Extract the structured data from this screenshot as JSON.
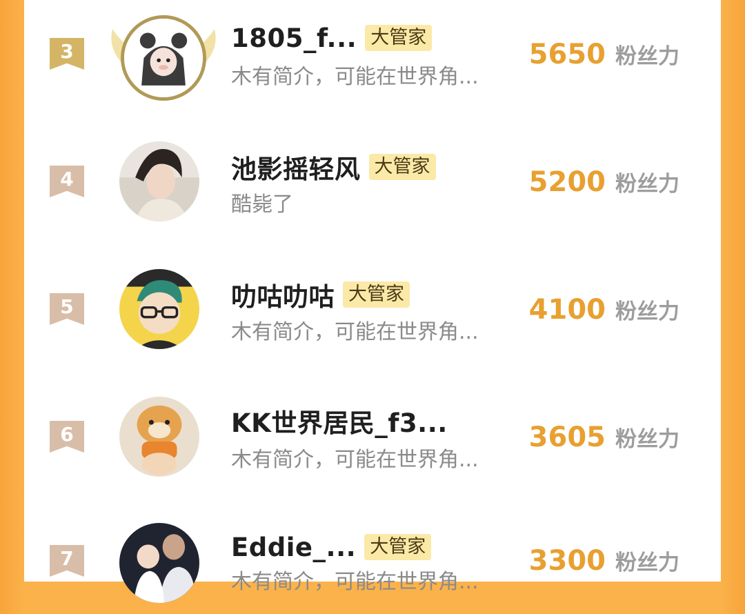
{
  "rows": [
    {
      "rank": "3",
      "name": "1805_f...",
      "badge": "大管家",
      "bio": "木有简介，可能在世界角...",
      "score": "5650",
      "unit": "粉丝力"
    },
    {
      "rank": "4",
      "name": "池影摇轻风",
      "badge": "大管家",
      "bio": "酷毙了",
      "score": "5200",
      "unit": "粉丝力"
    },
    {
      "rank": "5",
      "name": "叻咕叻咕",
      "badge": "大管家",
      "bio": "木有简介，可能在世界角...",
      "score": "4100",
      "unit": "粉丝力"
    },
    {
      "rank": "6",
      "name": "KK世界居民_f3...",
      "badge": "",
      "bio": "木有简介，可能在世界角...",
      "score": "3605",
      "unit": "粉丝力"
    },
    {
      "rank": "7",
      "name": "Eddie_...",
      "badge": "大管家",
      "bio": "木有简介，可能在世界角...",
      "score": "3300",
      "unit": "粉丝力"
    }
  ],
  "colors": {
    "accent": "#e8a030",
    "rank_top": "#d3b565",
    "rank_other": "#d8bda8",
    "badge_bg": "#fbe9a8"
  }
}
